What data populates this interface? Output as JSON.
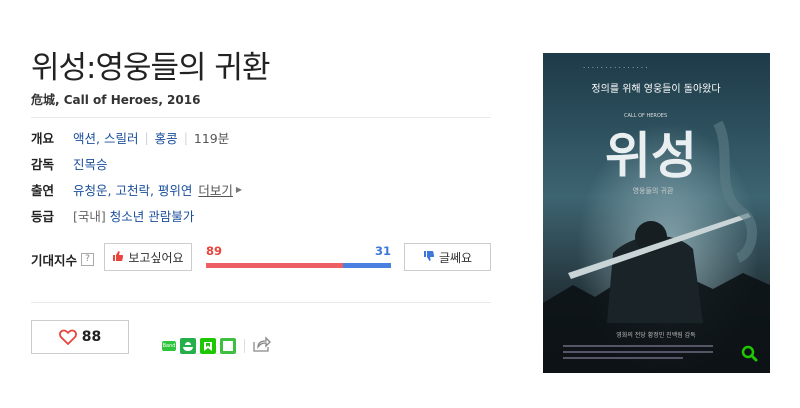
{
  "movie": {
    "title": "위성:영웅들의 귀환",
    "subtitle": "危城, Call of Heroes, 2016"
  },
  "info": {
    "overview": {
      "label": "개요",
      "genre": "액션, 스릴러",
      "country": "홍콩",
      "runtime": "119분"
    },
    "director": {
      "label": "감독",
      "name": "진목승"
    },
    "cast": {
      "label": "출연",
      "names": "유청운, 고천락, 평위연",
      "more": "더보기"
    },
    "rating": {
      "label": "등급",
      "region": "[국내]",
      "grade": "청소년 관람불가"
    }
  },
  "expectation": {
    "label": "기대지수",
    "help": "?",
    "like_label": "보고싶어요",
    "dislike_label": "글쎄요",
    "like_count": "89",
    "dislike_count": "31"
  },
  "favorites": {
    "count": "88"
  },
  "share": {
    "band_text": "Band"
  },
  "poster": {
    "top_text": "정의를 위해 영웅들이 돌아왔다",
    "big_title": "위성",
    "small_title": "영웅들의 귀환",
    "english_title": "CALL OF HEROES",
    "credits": "영화의 전당 황정민 진백림 감독"
  },
  "colors": {
    "like": "#e8453c",
    "dislike": "#3b78d9",
    "link": "#1b4f9c",
    "search": "#1ec800"
  },
  "icons": [
    "thumbs-up-icon",
    "thumbs-down-icon",
    "heart-icon",
    "band-icon",
    "kakaostory-icon",
    "blog-icon",
    "cafe-icon",
    "share-icon",
    "search-icon"
  ]
}
